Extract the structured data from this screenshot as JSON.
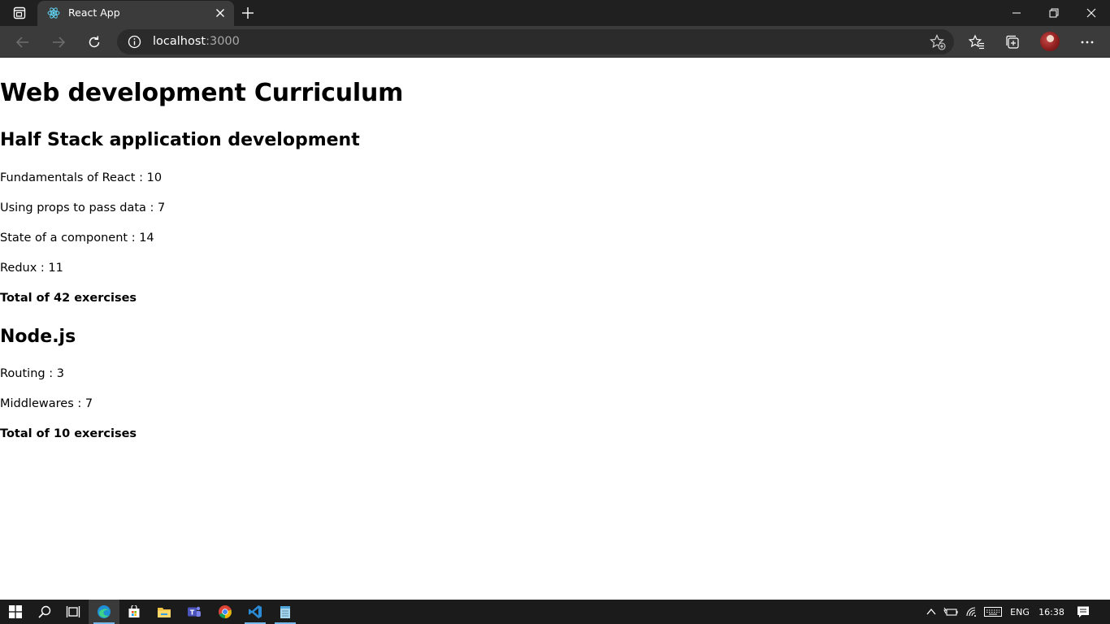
{
  "browser": {
    "tab": {
      "title": "React App"
    },
    "address_bar": {
      "host": "localhost",
      "port": ":3000"
    }
  },
  "page": {
    "title": "Web development Curriculum",
    "courses": [
      {
        "name": "Half Stack application development",
        "parts": [
          {
            "text": "Fundamentals of React : 10"
          },
          {
            "text": "Using props to pass data : 7"
          },
          {
            "text": "State of a component : 14"
          },
          {
            "text": "Redux : 11"
          }
        ],
        "total": "Total of 42 exercises"
      },
      {
        "name": "Node.js",
        "parts": [
          {
            "text": "Routing : 3"
          },
          {
            "text": "Middlewares : 7"
          }
        ],
        "total": "Total of 10 exercises"
      }
    ]
  },
  "taskbar": {
    "apps": [
      "start-icon",
      "search-icon",
      "task-view-icon",
      "edge-icon",
      "store-icon",
      "file-explorer-icon",
      "teams-icon",
      "chrome-icon",
      "vscode-icon",
      "notepad-icon"
    ],
    "language": "ENG",
    "clock": "16:38"
  },
  "colors": {
    "tabstrip": "#202020",
    "toolbar": "#3b3b3b",
    "omnibox": "#2b2b2b",
    "taskbar": "#1b1b1b",
    "accent": "#76b9ed"
  }
}
